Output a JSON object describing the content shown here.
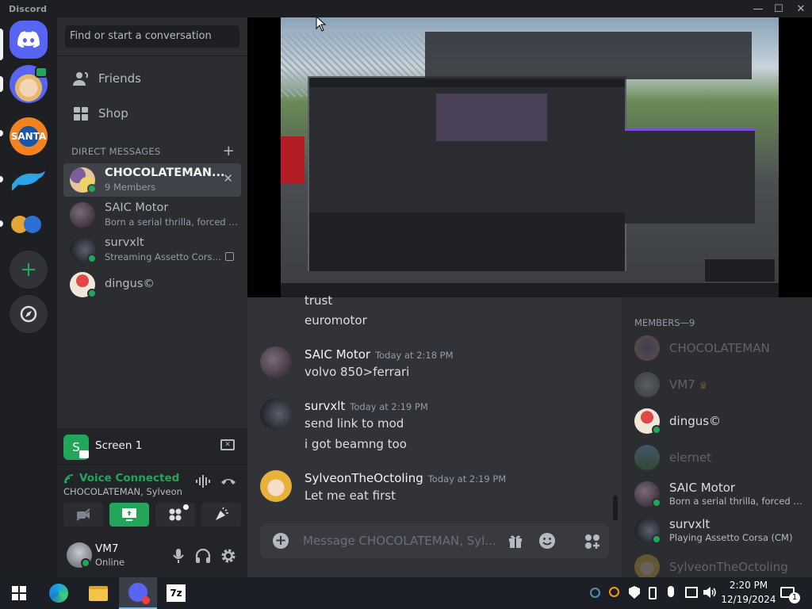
{
  "titlebar": {
    "app_name": "Discord",
    "minimize": "—",
    "maximize": "☐",
    "close": "✕"
  },
  "sidebar": {
    "search_placeholder": "Find or start a conversation",
    "nav": [
      {
        "label": "Friends",
        "icon": "friends-icon"
      },
      {
        "label": "Shop",
        "icon": "shop-icon"
      }
    ],
    "dm_header": "DIRECT MESSAGES",
    "dm_add": "+",
    "dms": [
      {
        "name": "CHOCOLATEMAN...",
        "sub": "9 Members",
        "active": true
      },
      {
        "name": "SAIC Motor",
        "sub": "Born a serial thrilla, forced to ..."
      },
      {
        "name": "survxlt",
        "sub": "Streaming Assetto Corsa (..."
      },
      {
        "name": "dingus©",
        "sub": ""
      }
    ]
  },
  "stream": {
    "title": "Screen 1",
    "initial": "S"
  },
  "voice": {
    "status": "Voice Connected",
    "channel": "CHOCOLATEMAN, Sylveon..."
  },
  "user": {
    "name": "VM7",
    "status": "Online"
  },
  "messages": [
    {
      "text_only": [
        "trust",
        "euromotor"
      ]
    },
    {
      "author": "SAIC Motor",
      "time": "Today at 2:18 PM",
      "lines": [
        "volvo 850>ferrari"
      ]
    },
    {
      "author": "survxlt",
      "time": "Today at 2:19 PM",
      "lines": [
        "send link to mod",
        "i got beamng too"
      ]
    },
    {
      "author": "SylveonTheOctoling",
      "time": "Today at 2:19 PM",
      "lines": [
        "Let me eat first"
      ]
    }
  ],
  "composer": {
    "placeholder": "Message CHOCOLATEMAN, Syl..."
  },
  "members": {
    "header": "MEMBERS—9",
    "list": [
      {
        "name": "CHOCOLATEMAN",
        "sub": "",
        "offline": true
      },
      {
        "name": "VM7",
        "sub": "",
        "offline": true,
        "crown": "♛"
      },
      {
        "name": "dingus©",
        "sub": "",
        "offline": false
      },
      {
        "name": "elernet",
        "sub": "",
        "offline": true
      },
      {
        "name": "SAIC Motor",
        "sub": "Born a serial thrilla, forced to ...",
        "offline": false
      },
      {
        "name": "survxlt",
        "sub": "Playing Assetto Corsa (CM)",
        "offline": false
      },
      {
        "name": "SylveonTheOctoling",
        "sub": "",
        "offline": true
      }
    ]
  },
  "taskbar": {
    "time": "2:20 PM",
    "date": "12/19/2024",
    "notif_count": "1",
    "app_7z": "7z"
  },
  "colors": {
    "green": "#23a55a",
    "blurple": "#5865f2",
    "bg_dark": "#1e1f22"
  }
}
